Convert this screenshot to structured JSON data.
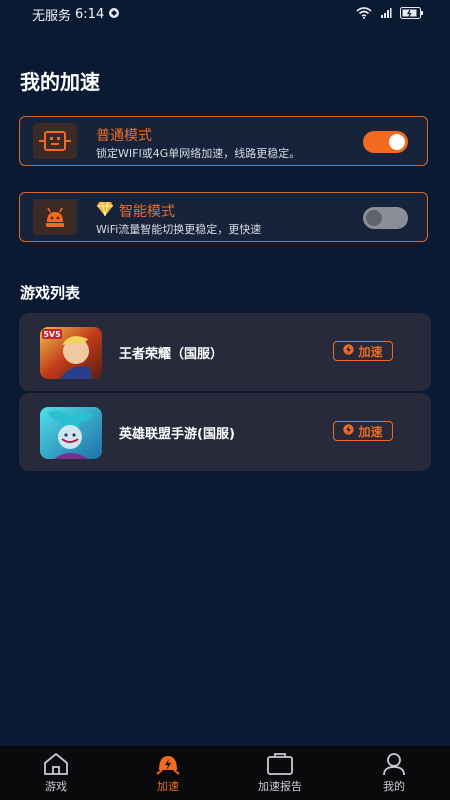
{
  "status": {
    "carrier": "无服务",
    "time": "6:14",
    "battery": ""
  },
  "page_title": "我的加速",
  "modes": {
    "normal": {
      "title": "普通模式",
      "desc": "锁定WIFI或4G单网络加速，线路更稳定。",
      "enabled": true
    },
    "smart": {
      "title": "智能模式",
      "desc": "WiFi流量智能切换更稳定，更快速",
      "enabled": false
    }
  },
  "game_list": {
    "title": "游戏列表",
    "games": [
      {
        "name": "王者荣耀（国服）",
        "button": "加速",
        "badge": "5V5"
      },
      {
        "name": "英雄联盟手游(国服)",
        "button": "加速"
      }
    ]
  },
  "tabs": [
    {
      "label": "游戏",
      "icon": "home-icon"
    },
    {
      "label": "加速",
      "icon": "accelerate-icon",
      "active": true
    },
    {
      "label": "加速报告",
      "icon": "report-icon"
    },
    {
      "label": "我的",
      "icon": "profile-icon"
    }
  ],
  "colors": {
    "accent": "#f26a1f",
    "background": "#0b1a33",
    "card": "#272a3a"
  }
}
